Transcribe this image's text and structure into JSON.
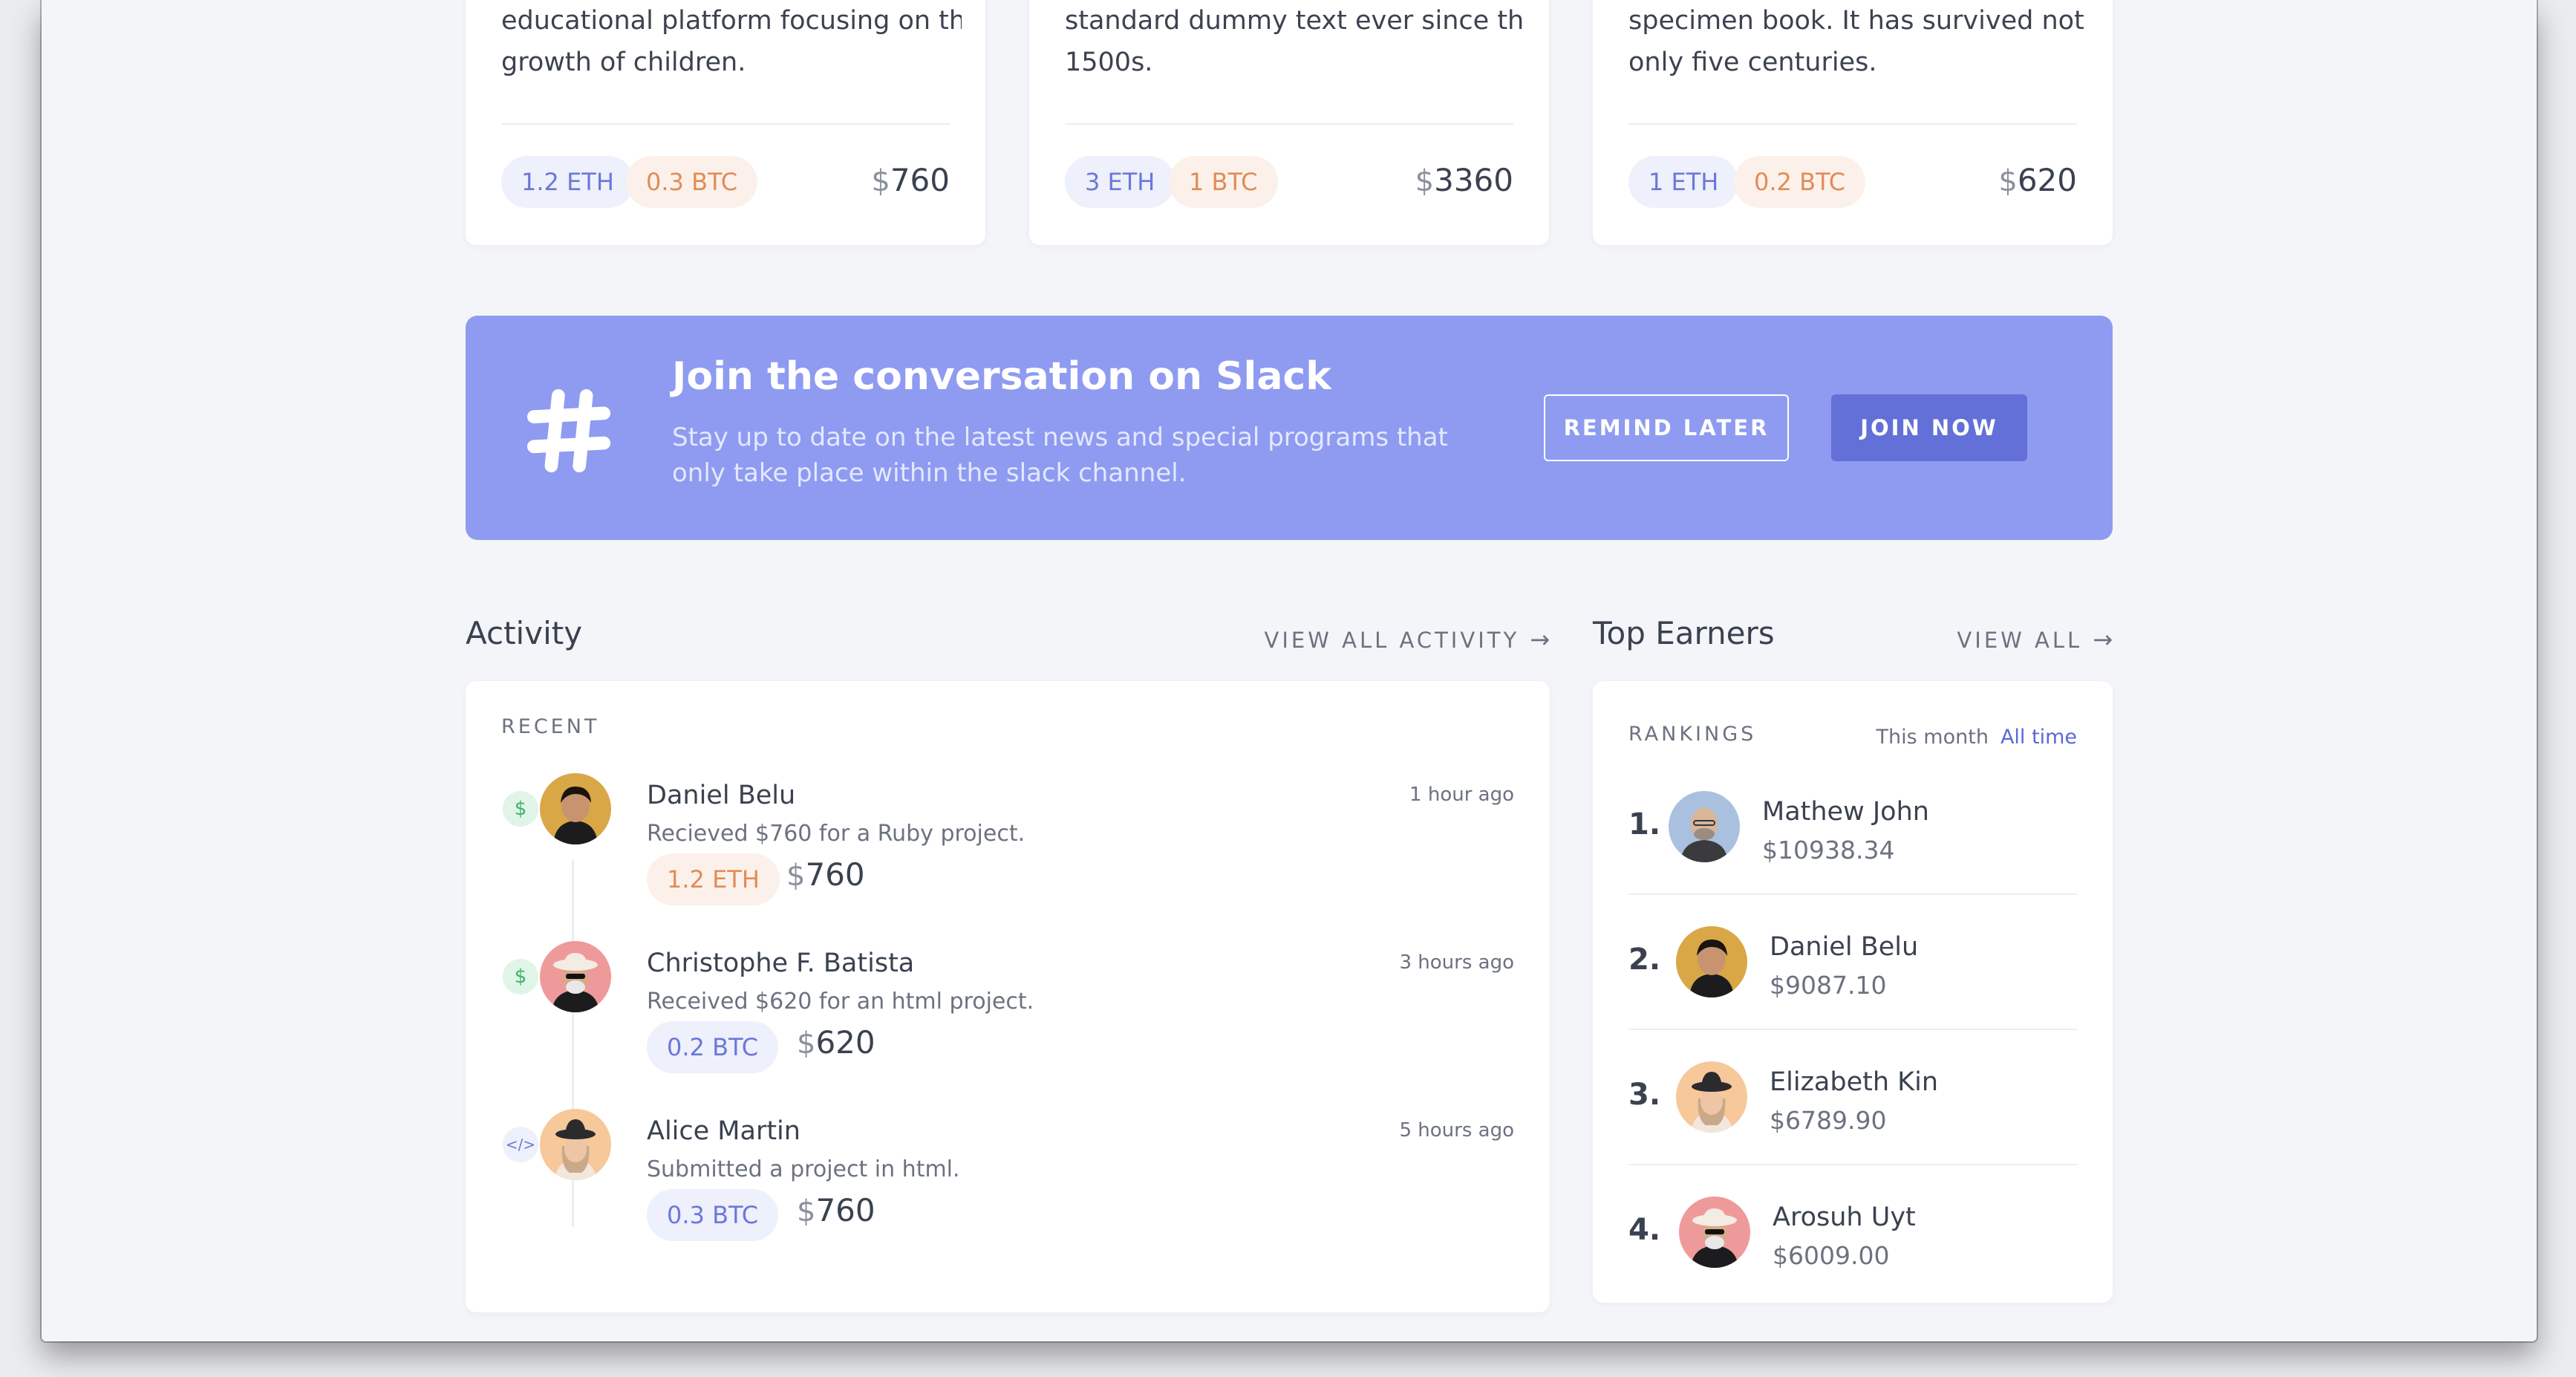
{
  "cards": [
    {
      "desc_lines": [
        "",
        "educational platform focusing on the",
        "growth of children."
      ],
      "eth": "1.2 ETH",
      "btc": "0.3 BTC",
      "currency": "$",
      "amount": "760"
    },
    {
      "desc_lines": [
        "",
        "standard dummy text ever since the",
        "1500s."
      ],
      "eth": "3 ETH",
      "btc": "1 BTC",
      "currency": "$",
      "amount": "3360"
    },
    {
      "desc_lines": [
        "",
        "specimen book. It has survived not",
        "only five centuries."
      ],
      "eth": "1 ETH",
      "btc": "0.2 BTC",
      "currency": "$",
      "amount": "620"
    }
  ],
  "slack": {
    "icon": "hash-icon",
    "title": "Join the conversation on Slack",
    "subtitle": "Stay up to date on the latest news and special programs that only take place within the slack channel.",
    "remind_label": "REMIND LATER",
    "join_label": "JOIN NOW"
  },
  "activity": {
    "title": "Activity",
    "view_all": "VIEW ALL ACTIVITY",
    "section_label": "RECENT",
    "items": [
      {
        "type_icon": "dollar-icon",
        "type_glyph": "$",
        "name": "Daniel Belu",
        "time": "1 hour ago",
        "text": "Recieved $760 for a Ruby project.",
        "coin": "1.2 ETH",
        "currency": "$",
        "amount": "760"
      },
      {
        "type_icon": "dollar-icon",
        "type_glyph": "$",
        "name": "Christophe F. Batista",
        "time": "3 hours ago",
        "text": "Received $620 for an html project.",
        "coin": "0.2 BTC",
        "currency": "$",
        "amount": "620"
      },
      {
        "type_icon": "code-icon",
        "type_glyph": "</>",
        "name": "Alice Martin",
        "time": "5 hours ago",
        "text": "Submitted a project in html.",
        "coin": "0.3 BTC",
        "currency": "$",
        "amount": "760"
      }
    ]
  },
  "earners": {
    "title": "Top Earners",
    "view_all": "VIEW ALL",
    "section_label": "RANKINGS",
    "tab_month": "This month",
    "tab_all": "All time",
    "items": [
      {
        "rank": "1.",
        "name": "Mathew John",
        "amount": "$10938.34"
      },
      {
        "rank": "2.",
        "name": "Daniel Belu",
        "amount": "$9087.10"
      },
      {
        "rank": "3.",
        "name": "Elizabeth Kin",
        "amount": "$6789.90"
      },
      {
        "rank": "4.",
        "name": "Arosuh Uyt",
        "amount": "$6009.00"
      }
    ]
  },
  "colors": {
    "accent": "#6370d8",
    "banner": "#8e9bf0",
    "eth_text": "#6b78d9",
    "btc_text": "#e28c56"
  }
}
